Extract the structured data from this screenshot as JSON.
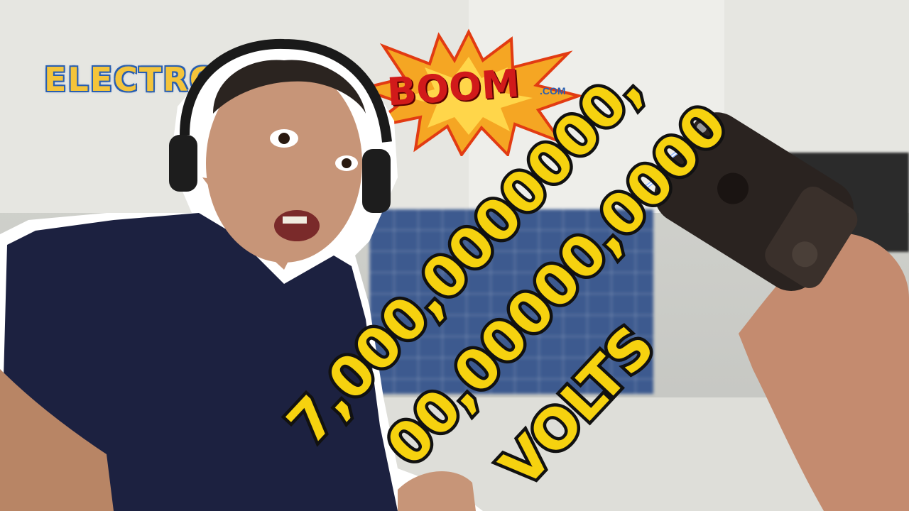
{
  "logo": {
    "text_left": "ELECTRO",
    "text_boom": "BOOM",
    "text_dotcom": ".COM"
  },
  "caption": {
    "line1": "7,000,0000000,",
    "line2": "00,00000,0000",
    "line3": "VOLTS",
    "fill_color": "#f6d20f",
    "stroke_color": "#111111"
  }
}
